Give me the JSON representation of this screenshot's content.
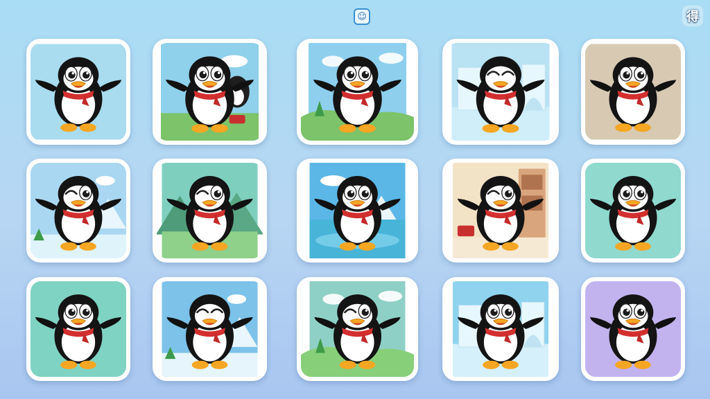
{
  "header": {
    "center_icon": "card-back-icon",
    "center_glyph": "☺",
    "corner_icon": "settings-glyph-icon",
    "corner_glyph": "得"
  },
  "cards": [
    {
      "bg": "#a9dcef",
      "ground": "#a9dcef",
      "eyes": "open",
      "scene": "plain"
    },
    {
      "bg": "#8fd0ea",
      "ground": "#7cc36a",
      "eyes": "open",
      "scene": "friend"
    },
    {
      "bg": "#8ecfee",
      "ground": "#7cc36a",
      "eyes": "open",
      "scene": "hills"
    },
    {
      "bg": "#b9e2f3",
      "ground": "#cfeefa",
      "eyes": "closed",
      "scene": "ice"
    },
    {
      "bg": "#d8c9b3",
      "ground": "#d8c9b3",
      "eyes": "open",
      "scene": "plain"
    },
    {
      "bg": "#a9d7f1",
      "ground": "#dff3fb",
      "eyes": "wink",
      "scene": "snow"
    },
    {
      "bg": "#7fcfbf",
      "ground": "#8fd08a",
      "eyes": "wink",
      "scene": "mountains"
    },
    {
      "bg": "#5bb7e6",
      "ground": "#47b4d8",
      "eyes": "open",
      "scene": "lake"
    },
    {
      "bg": "#f2e2c6",
      "ground": "#f6e9d3",
      "eyes": "wink",
      "scene": "room"
    },
    {
      "bg": "#8fd9cf",
      "ground": "#8fd9cf",
      "eyes": "open",
      "scene": "plain"
    },
    {
      "bg": "#7fd3c2",
      "ground": "#7fd3c2",
      "eyes": "open",
      "scene": "plain"
    },
    {
      "bg": "#7cc2e9",
      "ground": "#e5f5fb",
      "eyes": "closed",
      "scene": "snow"
    },
    {
      "bg": "#8fd0c6",
      "ground": "#88cf7a",
      "eyes": "wink",
      "scene": "hills"
    },
    {
      "bg": "#8fd3ee",
      "ground": "#d5f0fa",
      "eyes": "open",
      "scene": "ice"
    },
    {
      "bg": "#c2b3ef",
      "ground": "#c2b3ef",
      "eyes": "open",
      "scene": "plain"
    }
  ]
}
